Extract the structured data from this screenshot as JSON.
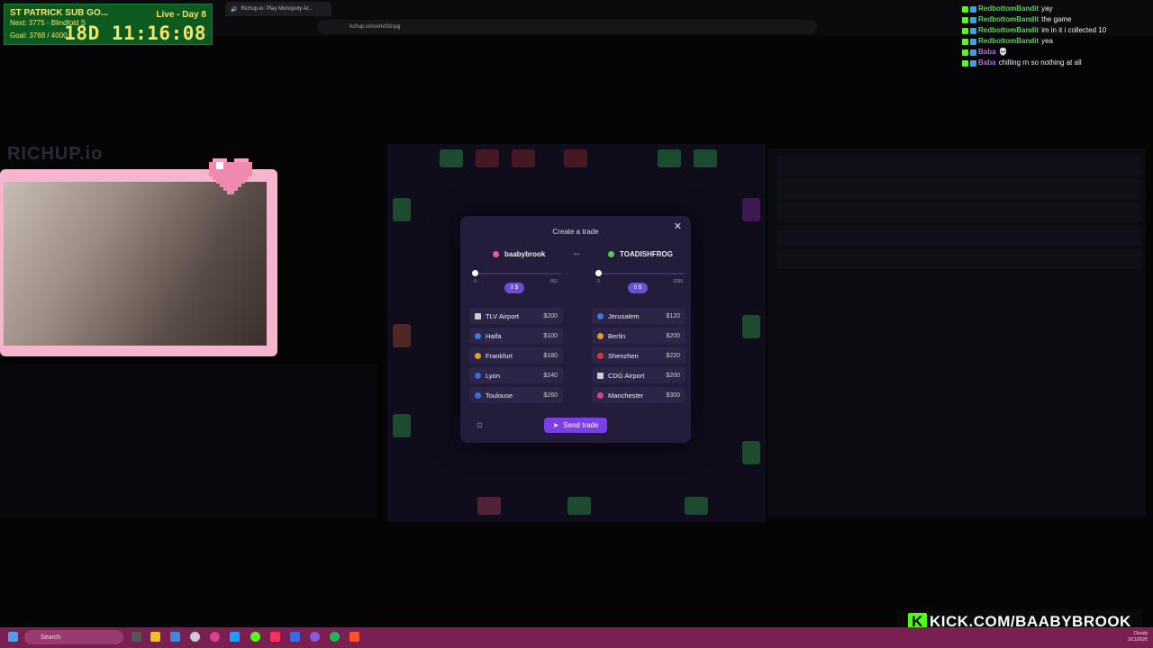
{
  "browser": {
    "tab_title": "Richup.io: Play Monopoly Al...",
    "url": "richup.io/room/0znpg"
  },
  "timer": {
    "title": "ST PATRICK SUB GO...",
    "next": "Next: 3775 - Blindfold S",
    "goal": "Goal: 3768 / 4000",
    "live_day": "Live - Day 8",
    "time": "18D 11:16:08"
  },
  "chat": [
    {
      "name": "RedbottomBandit",
      "msg": "yay",
      "color": "#5ad35a"
    },
    {
      "name": "RedbottomBandit",
      "msg": "the game",
      "color": "#5ad35a"
    },
    {
      "name": "RedbottomBandit",
      "msg": "im in it i collected 10",
      "color": "#5ad35a"
    },
    {
      "name": "RedbottomBandit",
      "msg": "yea",
      "color": "#5ad35a"
    },
    {
      "name": "Baba",
      "msg": "💀",
      "color": "#b46be0"
    },
    {
      "name": "Baba",
      "msg": "chilling rn so nothing at all",
      "color": "#b46be0"
    }
  ],
  "game": {
    "logo": "RICHUP.io"
  },
  "trade": {
    "title": "Create a trade",
    "left_player": {
      "name": "baabybrook",
      "color": "#ee5a9a",
      "slider_min": "0",
      "slider_max": "851",
      "money": "0 $",
      "slider_fraction": 0
    },
    "right_player": {
      "name": "TOADISHFROG",
      "color": "#58c84a",
      "slider_min": "0",
      "slider_max": "1036",
      "money": "0 $",
      "slider_fraction": 0
    },
    "left_properties": [
      {
        "name": "TLV Airport",
        "price": "$200",
        "icon": "airplane-icon",
        "color": "#cccccc"
      },
      {
        "name": "Haifa",
        "price": "$100",
        "icon": "israel-flag-icon",
        "color": "#3a7ae0"
      },
      {
        "name": "Frankfurt",
        "price": "$180",
        "icon": "germany-flag-icon",
        "color": "#e0a020"
      },
      {
        "name": "Lyon",
        "price": "$240",
        "icon": "france-flag-icon",
        "color": "#3a6ae0"
      },
      {
        "name": "Toulouse",
        "price": "$260",
        "icon": "france-flag-icon",
        "color": "#3a6ae0"
      }
    ],
    "right_properties": [
      {
        "name": "Jerusalem",
        "price": "$120",
        "icon": "israel-flag-icon",
        "color": "#3a7ae0"
      },
      {
        "name": "Berlin",
        "price": "$200",
        "icon": "germany-flag-icon",
        "color": "#e0a020"
      },
      {
        "name": "Shenzhen",
        "price": "$220",
        "icon": "china-flag-icon",
        "color": "#e03030"
      },
      {
        "name": "CDG Airport",
        "price": "$200",
        "icon": "airplane-icon",
        "color": "#cccccc"
      },
      {
        "name": "Manchester",
        "price": "$300",
        "icon": "uk-flag-icon",
        "color": "#e0408a"
      }
    ],
    "send_label": "Send trade"
  },
  "taskbar": {
    "search": "Search",
    "date": "3/11/2026",
    "weather": "Cloudy"
  },
  "kick_banner": {
    "k": "K",
    "text": "KICK.COM/BAABYBROOK"
  }
}
